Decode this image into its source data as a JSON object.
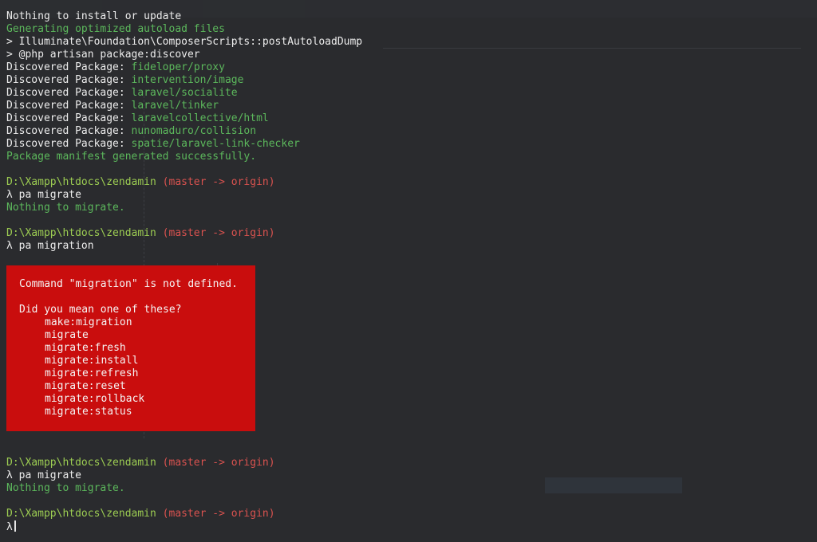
{
  "output": [
    {
      "text": "Nothing to install or update",
      "style": "white"
    },
    {
      "text": "Generating optimized autoload files",
      "style": "green"
    },
    {
      "text": "> Illuminate\\Foundation\\ComposerScripts::postAutoloadDump",
      "style": "white"
    },
    {
      "text": "> @php artisan package:discover",
      "style": "white"
    }
  ],
  "packages": {
    "prefix": "Discovered Package: ",
    "items": [
      "fideloper/proxy",
      "intervention/image",
      "laravel/socialite",
      "laravel/tinker",
      "laravelcollective/html",
      "nunomaduro/collision",
      "spatie/laravel-link-checker"
    ]
  },
  "manifest_message": "Package manifest generated successfully.",
  "prompt": {
    "path": "D:\\Xampp\\htdocs\\zendamin",
    "branch": "(master -> origin)",
    "symbol": "λ"
  },
  "sessions": [
    {
      "command": "pa migrate",
      "result": "Nothing to migrate."
    },
    {
      "command": "pa migration"
    }
  ],
  "error": {
    "message": "Command \"migration\" is not defined.",
    "suggestion_heading": "Did you mean one of these?",
    "suggestions": [
      "make:migration",
      "migrate",
      "migrate:fresh",
      "migrate:install",
      "migrate:refresh",
      "migrate:reset",
      "migrate:rollback",
      "migrate:status"
    ]
  },
  "final_session": {
    "command": "pa migrate",
    "result": "Nothing to migrate."
  },
  "colors": {
    "background": "#2a2b2e",
    "success": "#5cb85c",
    "branch": "#d9524f",
    "error_bg": "#c90d0d"
  }
}
